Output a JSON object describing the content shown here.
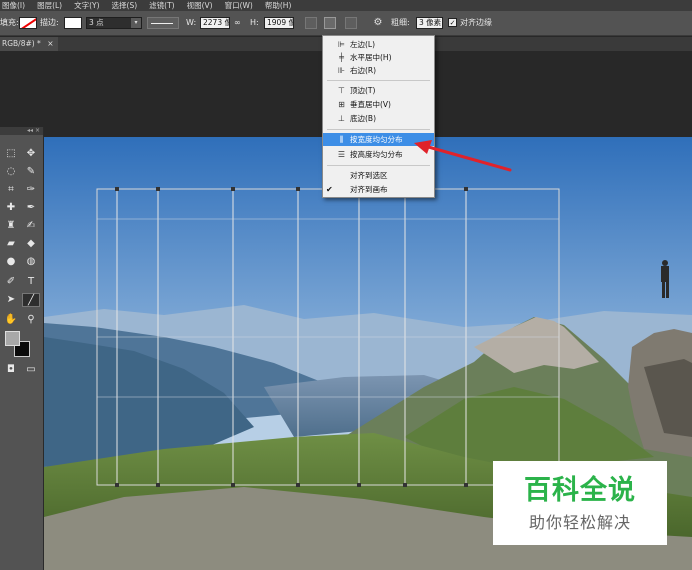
{
  "menubar": {
    "items": [
      "图像(I)",
      "图层(L)",
      "文字(Y)",
      "选择(S)",
      "滤镜(T)",
      "视图(V)",
      "窗口(W)",
      "帮助(H)"
    ]
  },
  "options": {
    "fill_label": "填充:",
    "stroke_label": "描边:",
    "stroke_width": "3 点",
    "w_label": "W:",
    "w_value": "2273 像",
    "link_glyph": "∞",
    "h_label": "H:",
    "h_value": "1909 像",
    "thickness_label": "粗细:",
    "thickness_value": "3 像素",
    "align_edges_label": "对齐边缘"
  },
  "document_tab": {
    "title": "RGB/8#) *",
    "close": "×"
  },
  "toolbox": {
    "header": "◂◂ ×"
  },
  "align_menu": {
    "items": [
      {
        "label": "左边(L)",
        "icon": "align-left-icon"
      },
      {
        "label": "水平居中(H)",
        "icon": "align-hcenter-icon"
      },
      {
        "label": "右边(R)",
        "icon": "align-right-icon"
      },
      {
        "label": "顶边(T)",
        "icon": "align-top-icon"
      },
      {
        "label": "垂直居中(V)",
        "icon": "align-vcenter-icon"
      },
      {
        "label": "底边(B)",
        "icon": "align-bottom-icon"
      },
      {
        "label": "按宽度均匀分布",
        "icon": "distribute-width-icon"
      },
      {
        "label": "按高度均匀分布",
        "icon": "distribute-height-icon"
      },
      {
        "label": "对齐到选区",
        "icon": ""
      },
      {
        "label": "对齐到画布",
        "icon": ""
      }
    ],
    "checked_mark": "✔"
  },
  "watermark": {
    "line1": "百科全说",
    "line2": "助你轻松解决"
  },
  "colors": {
    "menu_highlight": "#3d8ee6",
    "arrow": "#e0222a",
    "brand_green": "#2bb34a"
  }
}
